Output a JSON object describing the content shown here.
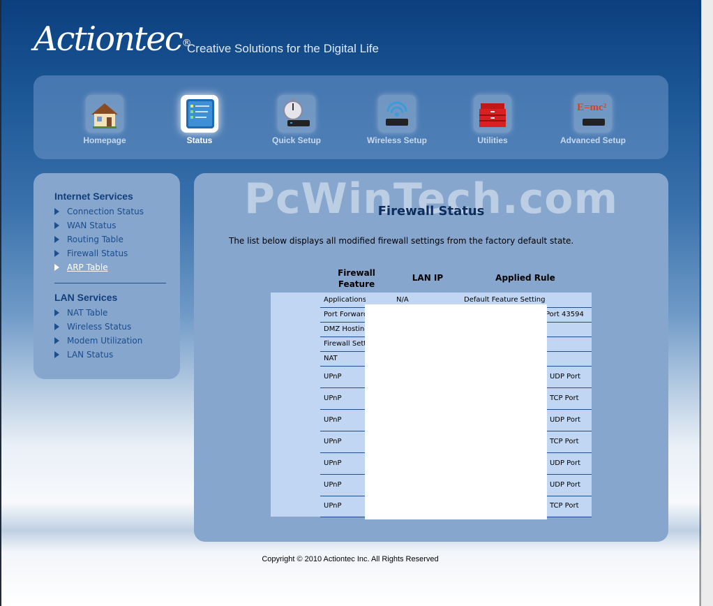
{
  "brand": {
    "logo": "Actiontec",
    "reg": "®",
    "tagline": "Creative Solutions for the Digital Life"
  },
  "nav": [
    {
      "label": "Homepage",
      "icon": "house-icon"
    },
    {
      "label": "Status",
      "icon": "status-monitor-icon"
    },
    {
      "label": "Quick Setup",
      "icon": "stopwatch-router-icon"
    },
    {
      "label": "Wireless Setup",
      "icon": "wireless-router-icon"
    },
    {
      "label": "Utilities",
      "icon": "toolbox-icon"
    },
    {
      "label": "Advanced Setup",
      "icon": "emc2-router-icon",
      "badge": "E=mc²"
    }
  ],
  "watermark": "PcWinTech.com",
  "sidebar": {
    "internet_heading": "Internet Services",
    "internet_items": [
      "Connection Status",
      "WAN Status",
      "Routing Table",
      "Firewall Status",
      "ARP Table"
    ],
    "lan_heading": "LAN Services",
    "lan_items": [
      "NAT Table",
      "Wireless Status",
      "Modem Utilization",
      "LAN Status"
    ]
  },
  "page": {
    "title": "Firewall Status",
    "description": "The list below displays all modified firewall settings from the factory default state."
  },
  "table": {
    "headers": [
      "Firewall Feature",
      "LAN IP",
      "Applied Rule"
    ],
    "rows": [
      {
        "feature": "Applications",
        "ip": "N/A",
        "rule": "Default Feature Setting"
      },
      {
        "feature": "Port Forward",
        "ip": "",
        "rule": "Port 43594"
      },
      {
        "feature": "DMZ Hosting",
        "ip": "",
        "rule": ""
      },
      {
        "feature": "Firewall Sett",
        "ip": "",
        "rule": ""
      },
      {
        "feature": "NAT",
        "ip": "",
        "rule": ""
      },
      {
        "feature": "UPnP",
        "ip": "",
        "rule": "l UDP Port"
      },
      {
        "feature": "UPnP",
        "ip": "",
        "rule": "l TCP Port"
      },
      {
        "feature": "UPnP",
        "ip": "",
        "rule": "l UDP Port"
      },
      {
        "feature": "UPnP",
        "ip": "",
        "rule": "l TCP Port"
      },
      {
        "feature": "UPnP",
        "ip": "",
        "rule": "l UDP Port"
      },
      {
        "feature": "UPnP",
        "ip": "",
        "rule": "l UDP Port"
      },
      {
        "feature": "UPnP",
        "ip": "",
        "rule": "l TCP Port"
      }
    ]
  },
  "footer": {
    "copyright": "Copyright © 2010 Actiontec Inc. All Rights Reserved"
  },
  "colors": {
    "panel": "#86a6ce",
    "table": "#c0d6f2",
    "heading": "#123f7a",
    "link": "#1a4d8e"
  }
}
